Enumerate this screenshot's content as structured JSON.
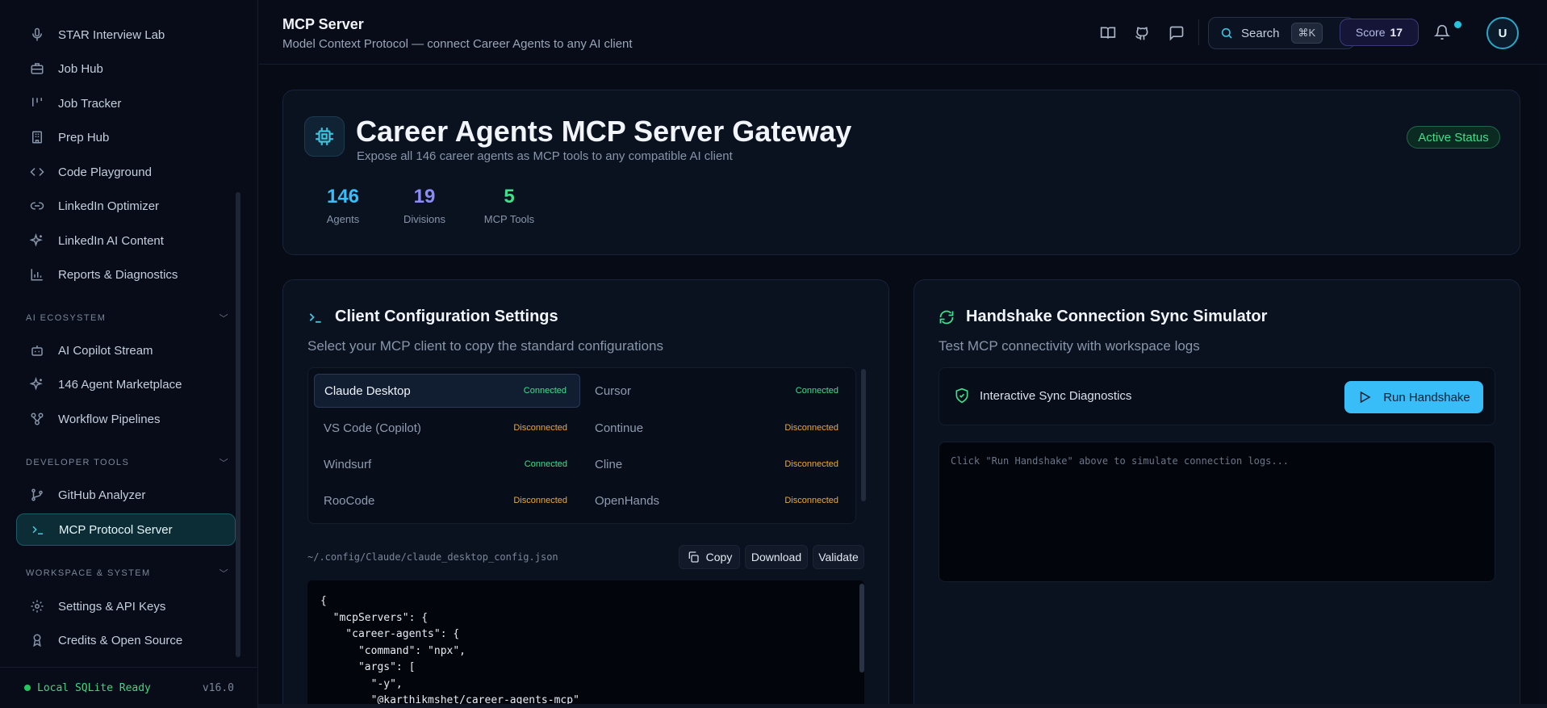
{
  "sidebar": {
    "items_top": [
      {
        "label": "STAR Interview Lab",
        "icon": "mic-icon"
      },
      {
        "label": "Job Hub",
        "icon": "briefcase-icon"
      },
      {
        "label": "Job Tracker",
        "icon": "kanban-icon"
      },
      {
        "label": "Prep Hub",
        "icon": "building-icon"
      },
      {
        "label": "Code Playground",
        "icon": "code-icon"
      },
      {
        "label": "LinkedIn Optimizer",
        "icon": "link-icon"
      },
      {
        "label": "LinkedIn AI Content",
        "icon": "sparkles-icon"
      },
      {
        "label": "Reports & Diagnostics",
        "icon": "bar-chart-icon"
      }
    ],
    "section_ai": "AI ECOSYSTEM",
    "items_ai": [
      {
        "label": "AI Copilot Stream",
        "icon": "bot-icon"
      },
      {
        "label": "146 Agent Marketplace",
        "icon": "sparkles-icon"
      },
      {
        "label": "Workflow Pipelines",
        "icon": "workflow-icon"
      }
    ],
    "section_dev": "DEVELOPER TOOLS",
    "items_dev": [
      {
        "label": "GitHub Analyzer",
        "icon": "git-branch-icon"
      },
      {
        "label": "MCP Protocol Server",
        "icon": "terminal-icon"
      }
    ],
    "section_ws": "WORKSPACE & SYSTEM",
    "items_ws": [
      {
        "label": "Settings & API Keys",
        "icon": "gear-icon"
      },
      {
        "label": "Credits & Open Source",
        "icon": "award-icon"
      }
    ],
    "footer_status": "Local SQLite Ready",
    "footer_version": "v16.0"
  },
  "header": {
    "title": "MCP Server",
    "subtitle": "Model Context Protocol — connect Career Agents to any AI client",
    "search_label": "Search",
    "search_kbd": "⌘K",
    "score_label": "Score",
    "score_value": "17",
    "avatar_initial": "U"
  },
  "hero": {
    "title": "Career Agents MCP Server Gateway",
    "subtitle": "Expose all 146 career agents as MCP tools to any compatible AI client",
    "status": "Active Status",
    "stats": [
      {
        "value": "146",
        "label": "Agents",
        "color": "#38bdf8"
      },
      {
        "value": "19",
        "label": "Divisions",
        "color": "#8b8cf6"
      },
      {
        "value": "5",
        "label": "MCP Tools",
        "color": "#3ee08c"
      }
    ]
  },
  "config": {
    "title": "Client Configuration Settings",
    "subtitle": "Select your MCP client to copy the standard configurations",
    "clients": [
      {
        "name": "Claude Desktop",
        "status": "Connected"
      },
      {
        "name": "Cursor",
        "status": "Connected"
      },
      {
        "name": "VS Code (Copilot)",
        "status": "Disconnected"
      },
      {
        "name": "Continue",
        "status": "Disconnected"
      },
      {
        "name": "Windsurf",
        "status": "Connected"
      },
      {
        "name": "Cline",
        "status": "Disconnected"
      },
      {
        "name": "RooCode",
        "status": "Disconnected"
      },
      {
        "name": "OpenHands",
        "status": "Disconnected"
      }
    ],
    "path": "~/.config/Claude/claude_desktop_config.json",
    "copy_label": "Copy",
    "download_label": "Download",
    "validate_label": "Validate",
    "code": "{\n  \"mcpServers\": {\n    \"career-agents\": {\n      \"command\": \"npx\",\n      \"args\": [\n        \"-y\",\n        \"@karthikmshet/career-agents-mcp\""
  },
  "handshake": {
    "title": "Handshake Connection Sync Simulator",
    "subtitle": "Test MCP connectivity with workspace logs",
    "diag_label": "Interactive Sync Diagnostics",
    "run_label": "Run Handshake",
    "logs_placeholder": "Click \"Run Handshake\" above to simulate connection logs..."
  }
}
